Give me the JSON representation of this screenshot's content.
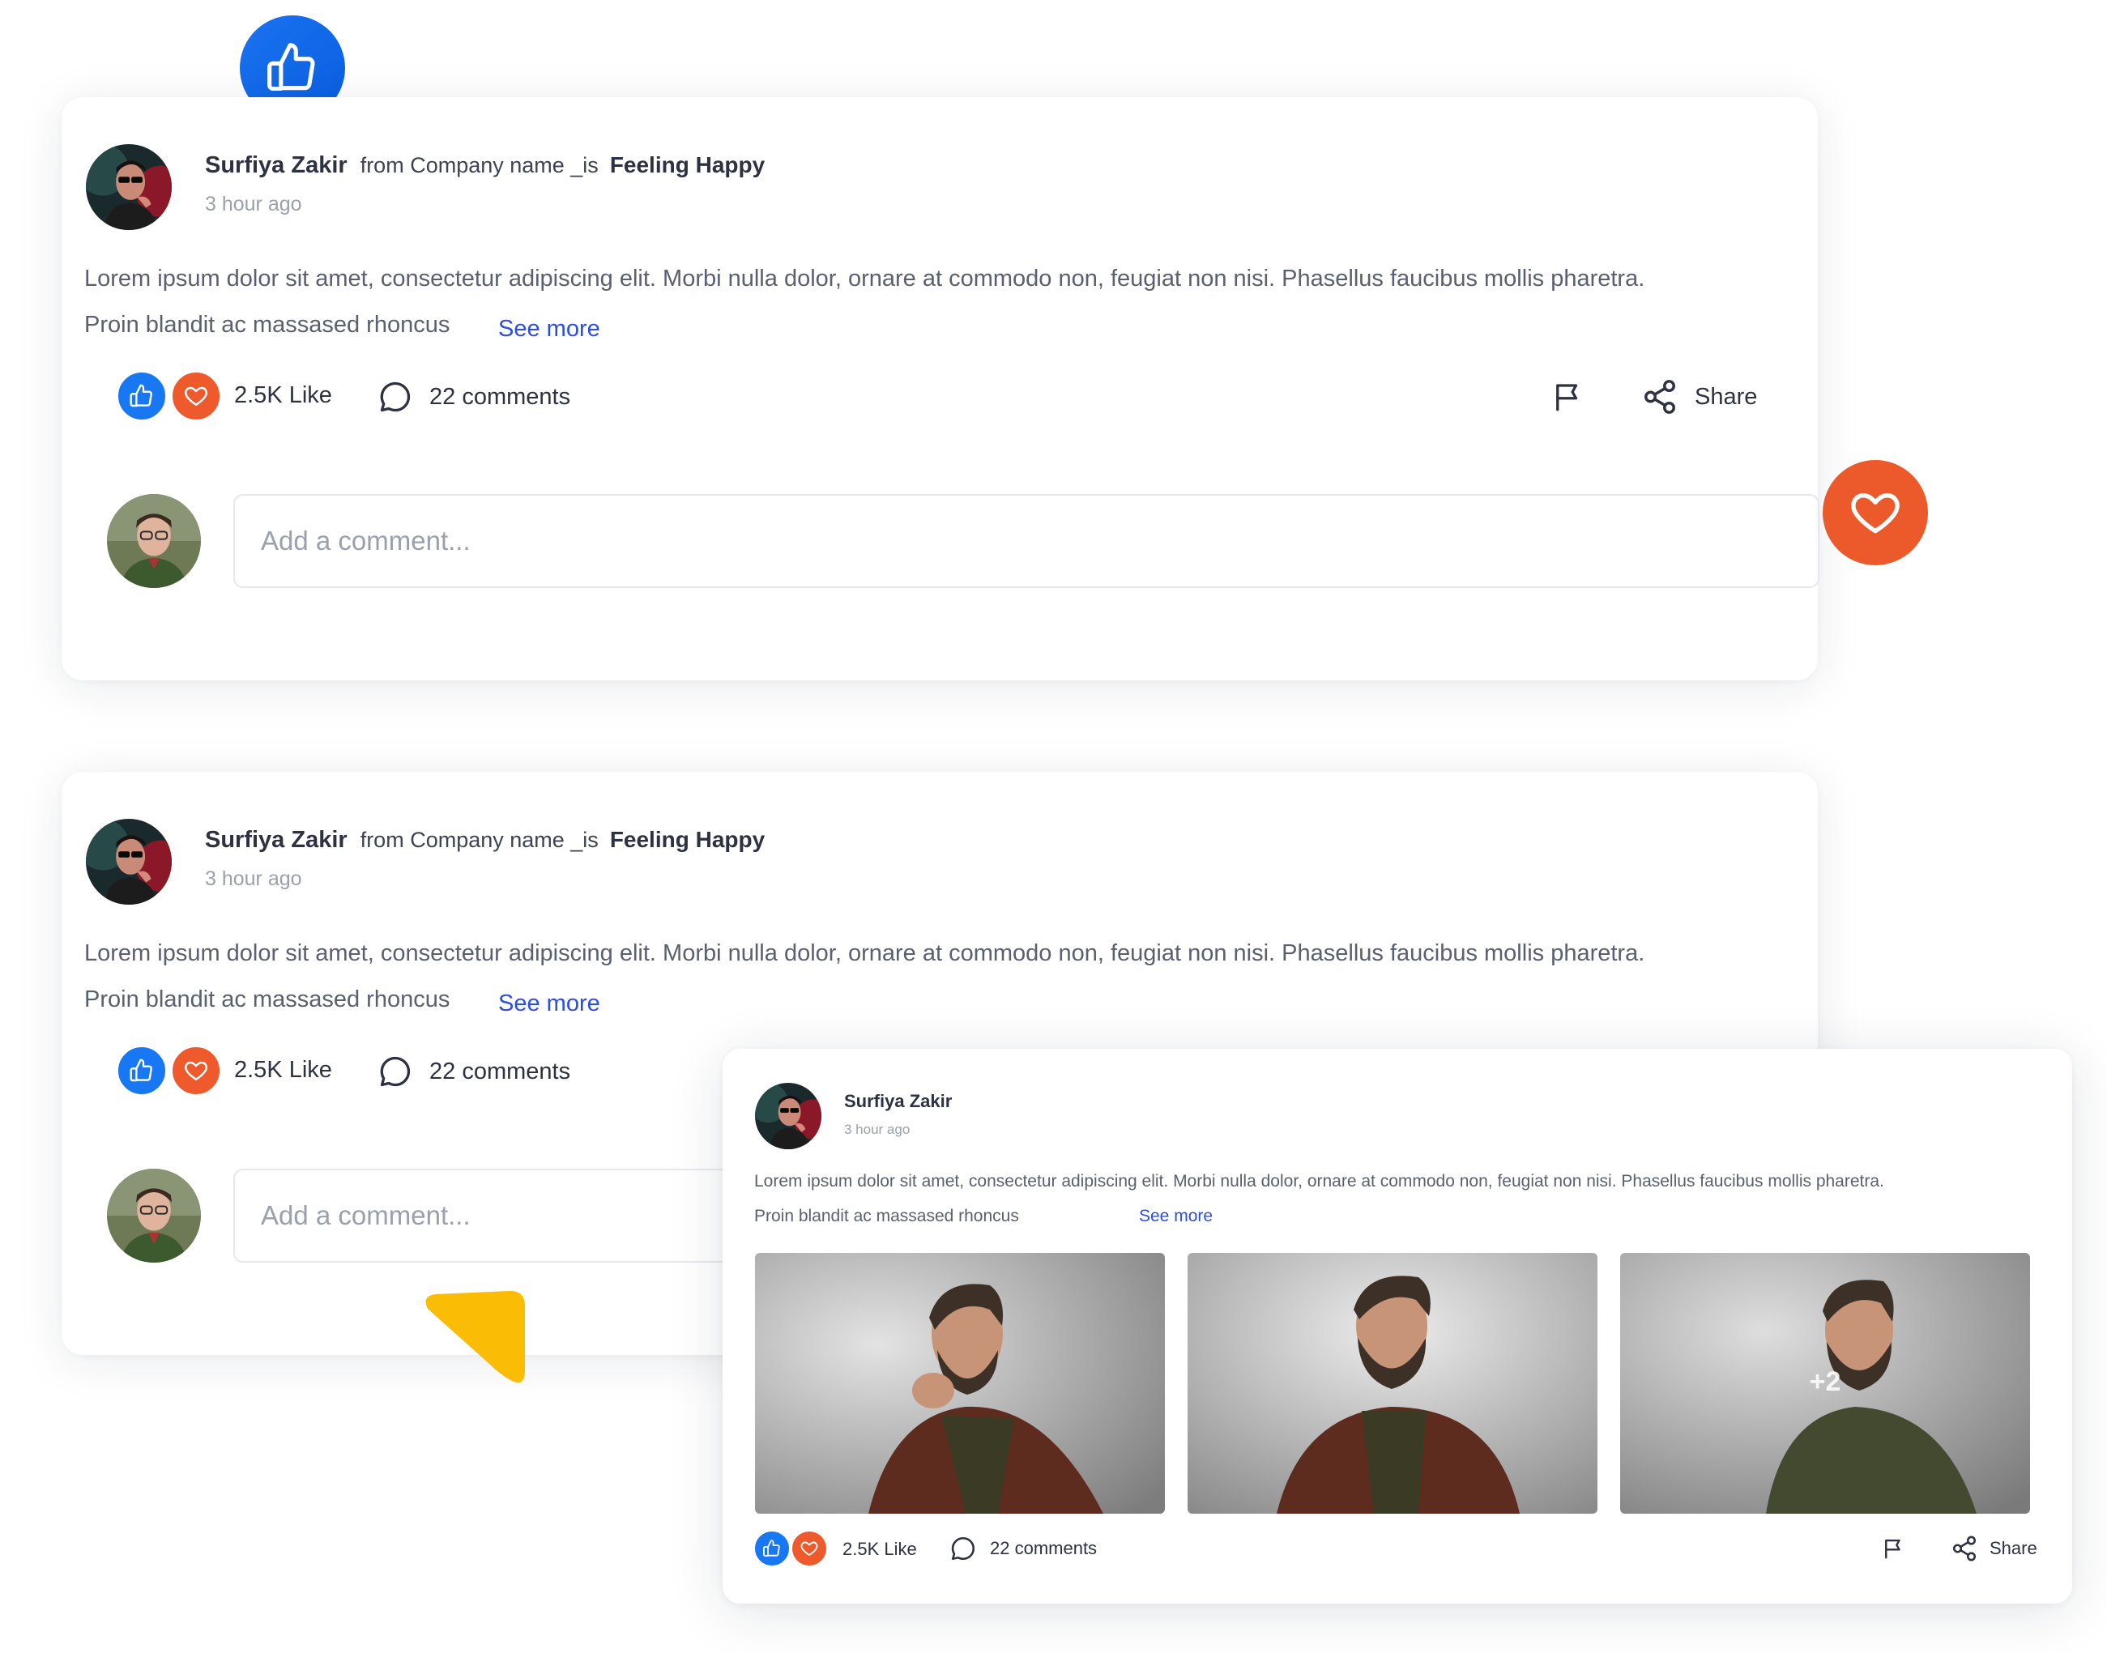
{
  "colors": {
    "accent_blue": "#1877f2",
    "accent_orange": "#ee5a2b",
    "link": "#2b4ee5",
    "cursor_yellow": "#fbbc05"
  },
  "posts": [
    {
      "author": "Surfiya Zakir",
      "from": "from Company name _is",
      "feeling": "Feeling Happy",
      "time": "3 hour ago",
      "body_line1": "Lorem ipsum dolor sit amet, consectetur adipiscing elit. Morbi nulla dolor, ornare at commodo non, feugiat non nisi. Phasellus faucibus mollis pharetra.",
      "body_line2": "Proin blandit ac massased rhoncus",
      "see_more": "See more",
      "likes": "2.5K Like",
      "comments": "22 comments",
      "share": "Share",
      "comment_placeholder": "Add a comment..."
    },
    {
      "author": "Surfiya Zakir",
      "from": "from Company name _is",
      "feeling": "Feeling Happy",
      "time": "3 hour ago",
      "body_line1": "Lorem ipsum dolor sit amet, consectetur adipiscing elit. Morbi nulla dolor, ornare at commodo non, feugiat non nisi. Phasellus faucibus mollis pharetra.",
      "body_line2": "Proin blandit ac massased rhoncus",
      "see_more": "See more",
      "likes": "2.5K Like",
      "comments": "22 comments",
      "comment_placeholder": "Add a comment..."
    },
    {
      "author": "Surfiya Zakir",
      "time": "3 hour ago",
      "body_line1": "Lorem ipsum dolor sit amet, consectetur adipiscing elit. Morbi nulla dolor, ornare at commodo non, feugiat non nisi. Phasellus faucibus mollis pharetra.",
      "body_line2": "Proin blandit ac massased rhoncus",
      "see_more": "See more",
      "photos_more": "+2",
      "likes": "2.5K Like",
      "comments": "22 comments",
      "share": "Share"
    }
  ],
  "icons": [
    "thumbs-up-icon",
    "heart-icon",
    "comment-icon",
    "flag-icon",
    "share-icon"
  ]
}
